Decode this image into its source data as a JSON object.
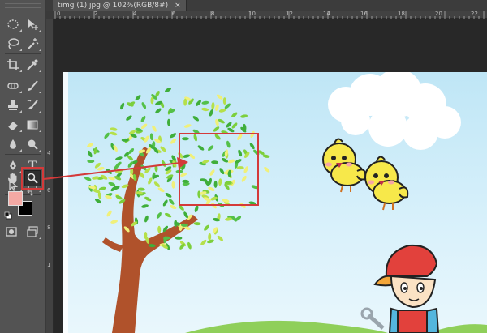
{
  "document": {
    "tab_title": "timg (1).jpg @ 102%(RGB/8#)",
    "close_glyph": "×"
  },
  "rulers": {
    "horizontal": [
      "0",
      "2",
      "4",
      "6",
      "8",
      "10",
      "12",
      "14",
      "16",
      "18",
      "20",
      "22"
    ],
    "vertical": [
      "4",
      "6",
      "8",
      "1"
    ]
  },
  "toolbar": {
    "tools": [
      {
        "name": "elliptical-marquee-icon"
      },
      {
        "name": "move-icon"
      },
      {
        "name": "lasso-icon"
      },
      {
        "name": "magic-wand-icon"
      },
      {
        "name": "crop-icon"
      },
      {
        "name": "eyedropper-icon"
      },
      {
        "name": "spot-healing-icon"
      },
      {
        "name": "brush-icon"
      },
      {
        "name": "clone-stamp-icon"
      },
      {
        "name": "history-brush-icon"
      },
      {
        "name": "eraser-icon"
      },
      {
        "name": "gradient-icon"
      },
      {
        "name": "blur-icon"
      },
      {
        "name": "dodge-icon"
      },
      {
        "name": "pen-icon"
      },
      {
        "name": "type-icon"
      },
      {
        "name": "path-selection-icon"
      },
      {
        "name": "rectangle-shape-icon"
      },
      {
        "name": "hand-icon"
      },
      {
        "name": "zoom-icon"
      }
    ],
    "type_glyph": "T",
    "colors": {
      "foreground": "#f4a9a4",
      "background": "#000000"
    }
  },
  "annotation": {
    "color": "#d43a3a"
  }
}
